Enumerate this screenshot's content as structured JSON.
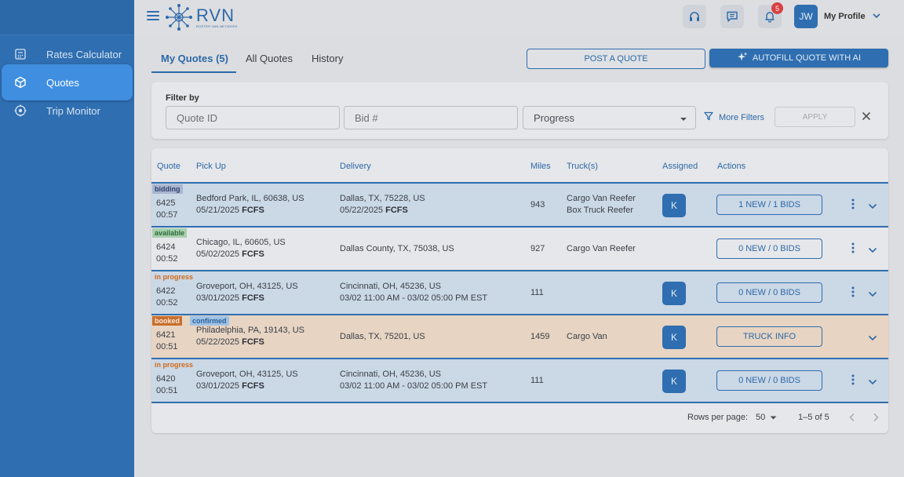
{
  "sidebar": {
    "items": [
      {
        "label": "Rates Calculator",
        "icon": "calculator-icon",
        "active": false
      },
      {
        "label": "Quotes",
        "icon": "cube-icon",
        "active": true
      },
      {
        "label": "Trip Monitor",
        "icon": "monitor-location-icon",
        "active": false
      }
    ]
  },
  "header": {
    "logo_text": "RVN",
    "logo_sub": "ROSTER VAN NETWORK",
    "notification_count": "5",
    "avatar_initials": "JW",
    "profile_label": "My Profile"
  },
  "tabs": [
    {
      "label": "My Quotes (5)",
      "active": true
    },
    {
      "label": "All Quotes",
      "active": false
    },
    {
      "label": "History",
      "active": false
    }
  ],
  "actions": {
    "post_quote": "POST A QUOTE",
    "autofill": "AUTOFILL QUOTE WITH AI"
  },
  "filter": {
    "label": "Filter by",
    "quote_id_placeholder": "Quote ID",
    "bid_placeholder": "Bid #",
    "progress_placeholder": "Progress",
    "more_filters": "More Filters",
    "apply": "APPLY"
  },
  "table": {
    "headers": {
      "quote": "Quote",
      "pickup": "Pick Up",
      "delivery": "Delivery",
      "miles": "Miles",
      "trucks": "Truck(s)",
      "assigned": "Assigned",
      "actions": "Actions"
    },
    "rows": [
      {
        "status": "bidding",
        "status2": "",
        "quote_id": "6425",
        "time": "00:57",
        "pickup_addr": "Bedford Park, IL, 60638, US",
        "pickup_date": "05/21/2025",
        "pickup_type": "FCFS",
        "delivery_addr": "Dallas, TX, 75228, US",
        "delivery_date": "05/22/2025",
        "delivery_type": "FCFS",
        "miles": "943",
        "truck1": "Cargo Van Reefer",
        "truck2": "Box Truck Reefer",
        "assigned": "K",
        "action": "1 NEW / 1 BIDS",
        "color": "blue",
        "kebab": true
      },
      {
        "status": "available",
        "status2": "",
        "quote_id": "6424",
        "time": "00:52",
        "pickup_addr": "Chicago, IL, 60605, US",
        "pickup_date": "05/02/2025",
        "pickup_type": "FCFS",
        "delivery_addr": "Dallas County, TX, 75038, US",
        "delivery_date": "",
        "delivery_type": "",
        "miles": "927",
        "truck1": "Cargo Van Reefer",
        "truck2": "",
        "assigned": "",
        "action": "0 NEW / 0 BIDS",
        "color": "white",
        "kebab": true
      },
      {
        "status": "in progress",
        "status2": "",
        "quote_id": "6422",
        "time": "00:52",
        "pickup_addr": "Groveport, OH, 43125, US",
        "pickup_date": "03/01/2025",
        "pickup_type": "FCFS",
        "delivery_addr": "Cincinnati, OH, 45236, US",
        "delivery_date": "03/02 11:00 AM - 03/02 05:00 PM EST",
        "delivery_type": "",
        "miles": "111",
        "truck1": "",
        "truck2": "",
        "assigned": "K",
        "action": "0 NEW / 0 BIDS",
        "color": "blue",
        "kebab": true
      },
      {
        "status": "booked",
        "status2": "confirmed",
        "quote_id": "6421",
        "time": "00:51",
        "pickup_addr": "Philadelphia, PA, 19143, US",
        "pickup_date": "05/22/2025",
        "pickup_type": "FCFS",
        "delivery_addr": "Dallas, TX, 75201, US",
        "delivery_date": "",
        "delivery_type": "",
        "miles": "1459",
        "truck1": "Cargo Van",
        "truck2": "",
        "assigned": "K",
        "action": "TRUCK INFO",
        "color": "orange",
        "kebab": false
      },
      {
        "status": "in progress",
        "status2": "",
        "quote_id": "6420",
        "time": "00:51",
        "pickup_addr": "Groveport, OH, 43125, US",
        "pickup_date": "03/01/2025",
        "pickup_type": "FCFS",
        "delivery_addr": "Cincinnati, OH, 45236, US",
        "delivery_date": "03/02 11:00 AM - 03/02 05:00 PM EST",
        "delivery_type": "",
        "miles": "111",
        "truck1": "",
        "truck2": "",
        "assigned": "K",
        "action": "0 NEW / 0 BIDS",
        "color": "blue",
        "kebab": true
      }
    ]
  },
  "pagination": {
    "rows_per_page_label": "Rows per page:",
    "rows_per_page": "50",
    "range": "1–5 of 5"
  }
}
